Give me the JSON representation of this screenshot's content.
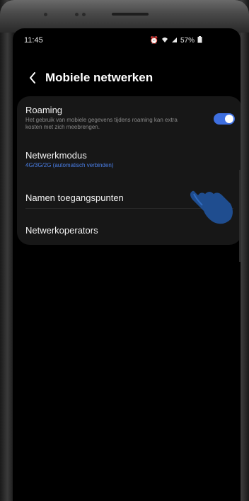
{
  "status": {
    "time": "11:45",
    "battery": "57%"
  },
  "header": {
    "title": "Mobiele netwerken"
  },
  "settings": {
    "roaming": {
      "title": "Roaming",
      "description": "Het gebruik van mobiele gegevens tijdens roaming kan extra kosten met zich meebrengen.",
      "enabled": true
    },
    "network_mode": {
      "title": "Netwerkmodus",
      "value": "4G/3G/2G (automatisch verbinden)"
    },
    "access_point_names": {
      "title": "Namen toegangspunten"
    },
    "network_operators": {
      "title": "Netwerkoperators"
    }
  },
  "colors": {
    "accent": "#3e6fe0",
    "subtitle_blue": "#4a7fe8",
    "card_bg": "#171717",
    "screen_bg": "#000000"
  }
}
